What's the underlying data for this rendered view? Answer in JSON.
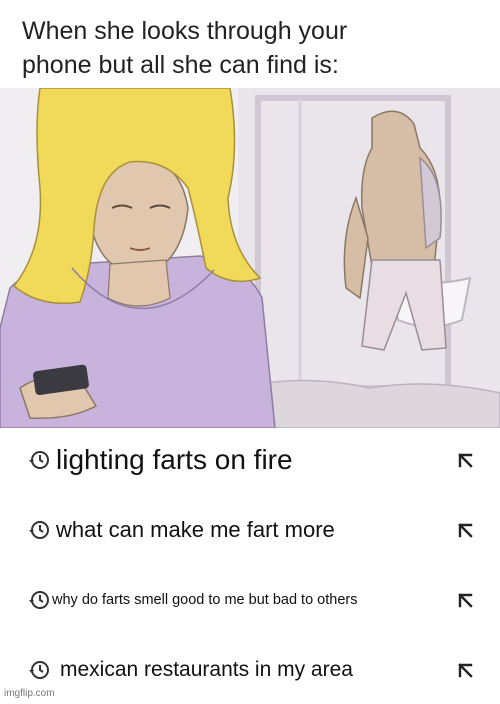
{
  "caption": {
    "line1": "When she looks through your",
    "line2": "phone but all she can find is:"
  },
  "history": [
    {
      "text": "lighting farts on fire",
      "icon": "history-icon",
      "action_icon": "arrow-up-left-icon"
    },
    {
      "text": "what can make me fart more",
      "icon": "history-icon",
      "action_icon": "arrow-up-left-icon"
    },
    {
      "text": "why do farts smell good to me but bad to others",
      "icon": "history-icon",
      "action_icon": "arrow-up-left-icon"
    },
    {
      "text": "mexican restaurants in my area",
      "icon": "history-icon",
      "action_icon": "arrow-up-left-icon"
    }
  ],
  "watermark": "imgflip.com",
  "colors": {
    "background": "#ffffff",
    "illustration_lavender": "#c9b6dc",
    "hair_yellow": "#f2dc5a",
    "skin": "#d8bfa4",
    "bathroom_bg": "#ece8ee"
  }
}
